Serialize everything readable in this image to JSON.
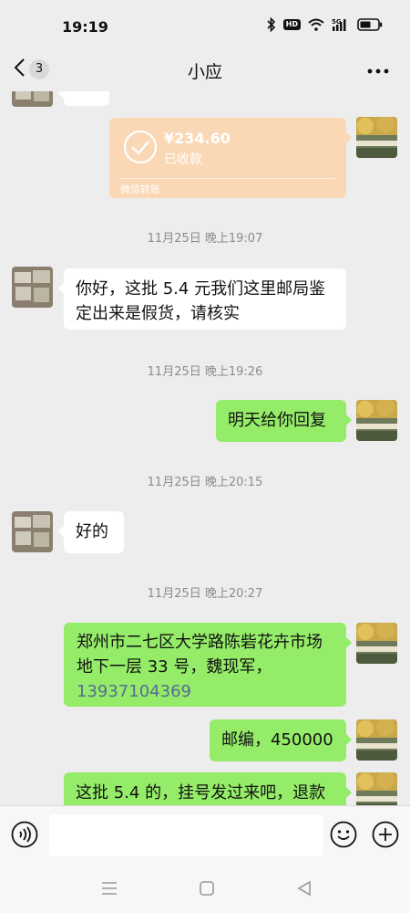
{
  "status_bar": {
    "time": "19:19",
    "icons": [
      "bluetooth-icon",
      "hd-badge",
      "wifi-icon",
      "5g-signal-icon",
      "battery-icon"
    ],
    "hd_label": "HD",
    "network_label": "5G"
  },
  "nav": {
    "back_count": "3",
    "title": "小应",
    "more_icon": "more-dots-icon"
  },
  "messages": {
    "transfer": {
      "amount": "¥234.60",
      "status": "已收款",
      "source": "微信转账"
    },
    "ts1": "11月25日 晚上19:07",
    "m1": "你好，这批 5.4 元我们这里邮局鉴定出来是假货，请核实",
    "ts2": "11月25日 晚上19:26",
    "m2": "明天给你回复",
    "ts3": "11月25日 晚上20:15",
    "m3": "好的",
    "ts4": "11月25日 晚上20:27",
    "m4_text": "郑州市二七区大学路陈砦花卉市场地下一层 33 号，魏现军，",
    "m4_phone": "13937104369",
    "m5": "邮编，450000",
    "m6": "这批 5.4 的，挂号发过来吧，退款"
  },
  "colors": {
    "background": "#ededed",
    "sent_bubble": "#95ec69",
    "received_bubble": "#ffffff",
    "transfer_card": "#fad8b6",
    "timestamp": "#8c8c8c",
    "link": "#576b95"
  },
  "input_bar": {
    "voice_icon": "voice-icon",
    "emoji_icon": "emoji-icon",
    "plus_icon": "plus-icon"
  },
  "system_nav": [
    "menu-icon",
    "home-icon",
    "back-triangle-icon"
  ]
}
